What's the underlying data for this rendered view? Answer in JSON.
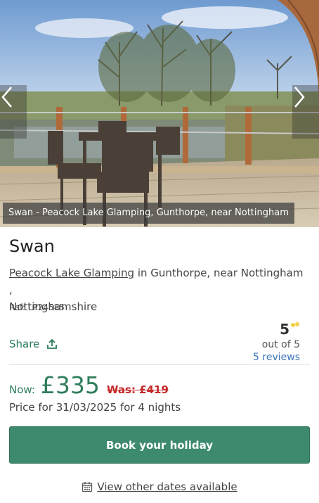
{
  "hero": {
    "caption": "Swan - Peacock Lake Glamping, Gunthorpe, near Nottingham"
  },
  "property": {
    "title": "Swan",
    "site_link": "Peacock Lake Glamping",
    "location_rest": " in Gunthorpe, near Nottingham ,",
    "county": "Nottinghamshire",
    "ref": "Ref: LP24585"
  },
  "share": {
    "label": "Share",
    "icon": "share-icon"
  },
  "rating": {
    "score": "5",
    "out_of": "out of 5",
    "reviews": "5 reviews",
    "icon": "sparkle-icon"
  },
  "pricing": {
    "now_label": "Now:",
    "now_price": "£335",
    "was_price": "Was: £419",
    "price_for": "Price for 31/03/2025 for 4 nights"
  },
  "actions": {
    "book_label": "Book your holiday",
    "other_dates_label": "View other dates available",
    "calendar_icon": "calendar-icon"
  },
  "colors": {
    "accent_green": "#3e8a6e",
    "price_green": "#2e7d5b",
    "was_red": "#c62828",
    "link_blue": "#3a73b5"
  }
}
